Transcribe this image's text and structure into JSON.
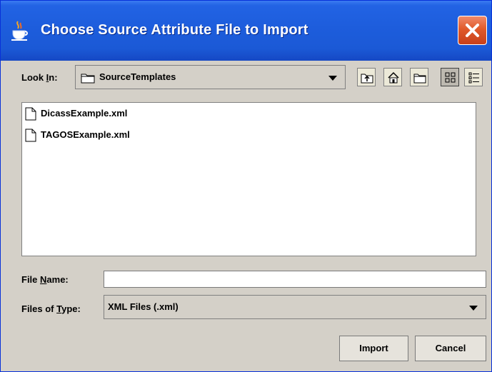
{
  "window": {
    "title": "Choose Source Attribute File to Import"
  },
  "look_in": {
    "label_prefix": "Look ",
    "label_mnemonic": "I",
    "label_suffix": "n:",
    "selected": "SourceTemplates"
  },
  "toolbar": {
    "buttons": [
      "up-one-level",
      "home",
      "new-folder",
      "list-view",
      "details-view"
    ],
    "active": "list-view"
  },
  "files": [
    {
      "name": "DicassExample.xml"
    },
    {
      "name": "TAGOSExample.xml"
    }
  ],
  "file_name": {
    "label_prefix": "File ",
    "label_mnemonic": "N",
    "label_suffix": "ame:",
    "value": ""
  },
  "file_type": {
    "label_prefix": "Files of ",
    "label_mnemonic": "T",
    "label_suffix": "ype:",
    "selected": "XML Files (.xml)"
  },
  "actions": {
    "import_label": "Import",
    "cancel_label": "Cancel"
  },
  "colors": {
    "titlebar": "#1d5ddc",
    "dialog_bg": "#d4d0c8",
    "close_button": "#e05a2a"
  }
}
